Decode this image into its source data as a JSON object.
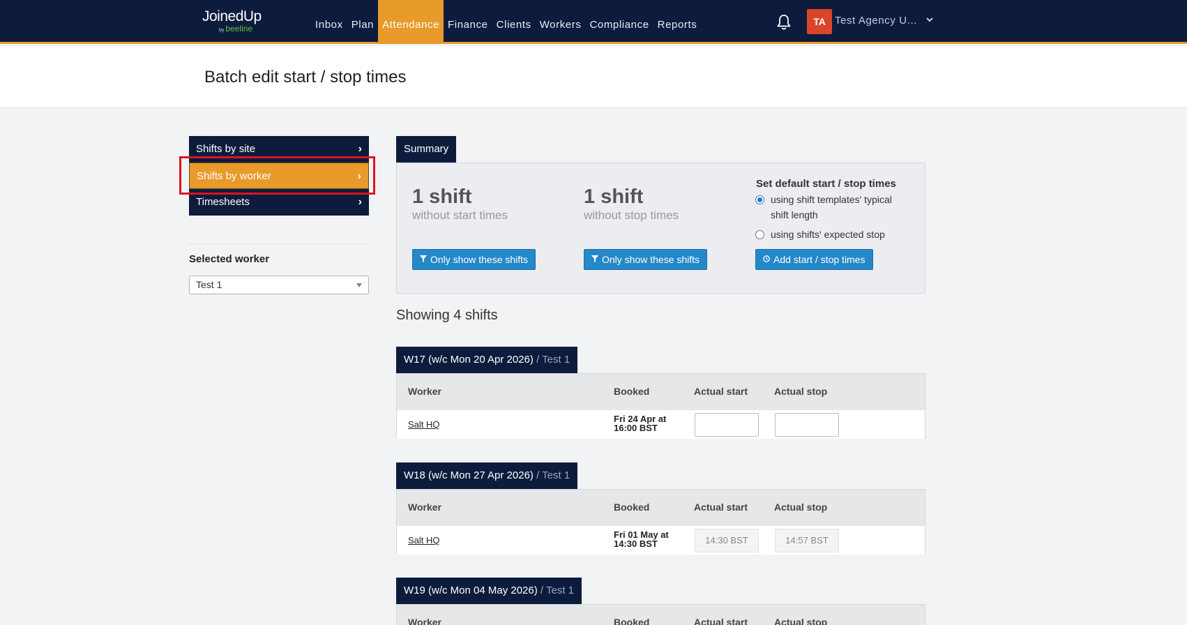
{
  "brand": {
    "name_part1": "Joined",
    "name_part2": "Up",
    "by": "by",
    "sub": "beeline"
  },
  "nav": {
    "items": [
      {
        "label": "Inbox"
      },
      {
        "label": "Plan"
      },
      {
        "label": "Attendance",
        "active": true
      },
      {
        "label": "Finance"
      },
      {
        "label": "Clients"
      },
      {
        "label": "Workers"
      },
      {
        "label": "Compliance"
      },
      {
        "label": "Reports"
      }
    ],
    "bell_icon": "bell-icon",
    "avatar_initials": "TA",
    "agency_name": "Test Agency U...",
    "caret_icon": "chevron-down-icon"
  },
  "page": {
    "title": "Batch edit start / stop times"
  },
  "sidebar": {
    "items": [
      {
        "label": "Shifts by site"
      },
      {
        "label": "Shifts by worker",
        "active": true
      },
      {
        "label": "Timesheets"
      }
    ],
    "selected_worker_label": "Selected worker",
    "selected_worker_value": "Test 1"
  },
  "summary": {
    "tab": "Summary",
    "col1": {
      "count": "1 shift",
      "desc": "without start times",
      "button": "Only show these shifts"
    },
    "col2": {
      "count": "1 shift",
      "desc": "without stop times",
      "button": "Only show these shifts"
    },
    "defaults": {
      "title": "Set default start / stop times",
      "option1_line1": "using shift templates' typical",
      "option1_line2": "shift length",
      "option2": "using shifts' expected stop",
      "selected": 1,
      "button": "Add start / stop times"
    }
  },
  "showing": "Showing 4 shifts",
  "table_headers": {
    "worker": "Worker",
    "booked": "Booked",
    "actual_start": "Actual start",
    "actual_stop": "Actual stop"
  },
  "weeks": [
    {
      "title": "W17 (w/c Mon 20 Apr 2026)",
      "sub": " / Test 1",
      "rows": [
        {
          "site": "Salt HQ",
          "booked_line1": "Fri 24 Apr at",
          "booked_line2": "16:00 BST",
          "actual_start": "",
          "actual_stop": ""
        }
      ]
    },
    {
      "title": "W18 (w/c Mon 27 Apr 2026)",
      "sub": " / Test 1",
      "rows": [
        {
          "site": "Salt HQ",
          "booked_line1": "Fri 01 May at",
          "booked_line2": "14:30 BST",
          "actual_start": "14:30 BST",
          "actual_stop": "14:57 BST"
        }
      ]
    },
    {
      "title": "W19 (w/c Mon 04 May 2026)",
      "sub": " / Test 1",
      "rows": []
    }
  ]
}
